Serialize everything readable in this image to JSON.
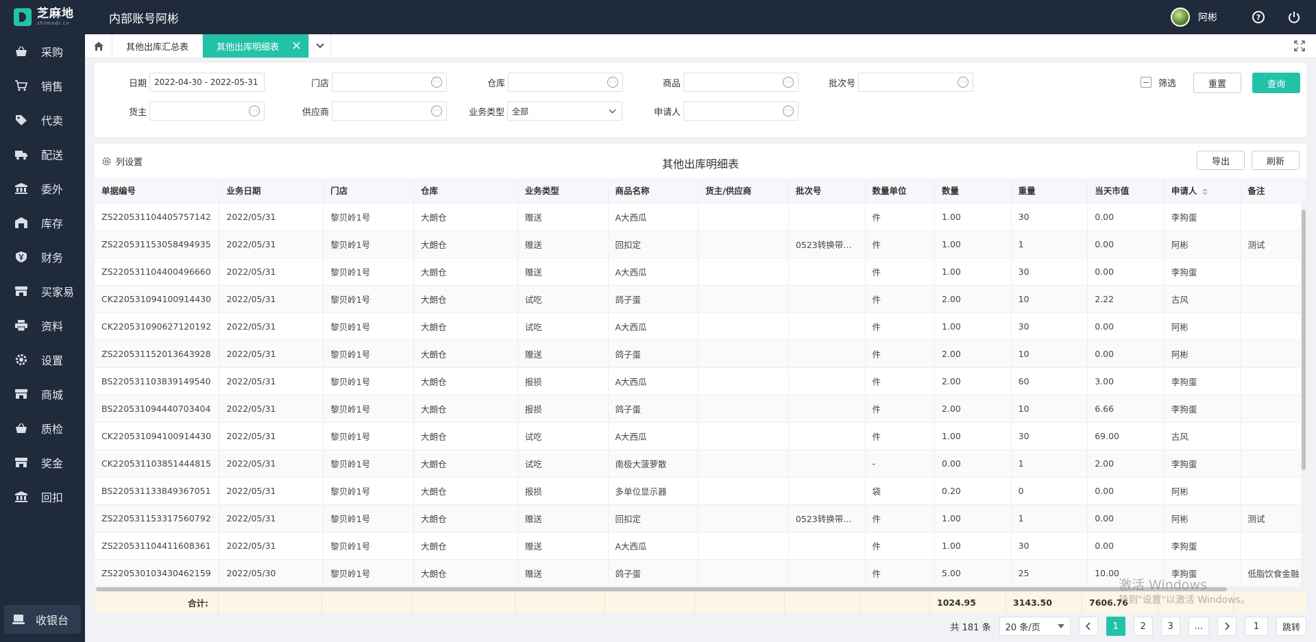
{
  "app": {
    "logo_text": "芝麻地",
    "logo_sub": "zhimadi.cn",
    "account_title": "内部账号阿彬",
    "username": "阿彬"
  },
  "colors": {
    "accent": "#23c2a8",
    "sidebar_bg": "#1f2a3b",
    "total_row_bg": "#fdf5e6"
  },
  "sidebar": {
    "items": [
      {
        "label": "采购",
        "icon": "basket-icon"
      },
      {
        "label": "销售",
        "icon": "cart-icon"
      },
      {
        "label": "代卖",
        "icon": "tag-icon"
      },
      {
        "label": "配送",
        "icon": "truck-icon"
      },
      {
        "label": "委外",
        "icon": "building-icon"
      },
      {
        "label": "库存",
        "icon": "warehouse-icon"
      },
      {
        "label": "财务",
        "icon": "yen-shield-icon"
      },
      {
        "label": "买家易",
        "icon": "store-icon"
      },
      {
        "label": "资料",
        "icon": "printer-icon"
      },
      {
        "label": "设置",
        "icon": "gear-icon"
      },
      {
        "label": "商城",
        "icon": "store-icon"
      },
      {
        "label": "质检",
        "icon": "basket-icon"
      },
      {
        "label": "奖金",
        "icon": "store-icon"
      },
      {
        "label": "回扣",
        "icon": "building-icon"
      }
    ],
    "cashier_label": "收银台"
  },
  "tabs": [
    {
      "label": "其他出库汇总表",
      "active": false
    },
    {
      "label": "其他出库明细表",
      "active": true
    }
  ],
  "filters": {
    "date_label": "日期",
    "date_value": "2022-04-30 - 2022-05-31",
    "store_label": "门店",
    "warehouse_label": "仓库",
    "product_label": "商品",
    "batch_label": "批次号",
    "owner_label": "货主",
    "supplier_label": "供应商",
    "biz_type_label": "业务类型",
    "biz_type_value": "全部",
    "applicant_label": "申请人",
    "filter_label": "筛选",
    "reset_label": "重置",
    "query_label": "查询"
  },
  "table_panel": {
    "col_settings_label": "列设置",
    "title": "其他出库明细表",
    "export_label": "导出",
    "refresh_label": "刷新"
  },
  "table": {
    "headers": [
      "单据编号",
      "业务日期",
      "门店",
      "仓库",
      "业务类型",
      "商品名称",
      "货主/供应商",
      "批次号",
      "数量单位",
      "数量",
      "重量",
      "当天市值",
      "申请人",
      "备注"
    ],
    "rows": [
      [
        "ZS220531104405757142",
        "2022/05/31",
        "黎贝岭1号",
        "大朗仓",
        "赠送",
        "A大西瓜",
        "",
        "",
        "件",
        "1.00",
        "30",
        "0.00",
        "李狗蛋",
        ""
      ],
      [
        "ZS220531153058494935",
        "2022/05/31",
        "黎贝岭1号",
        "大朗仓",
        "赠送",
        "回扣定",
        "",
        "0523转换带…",
        "件",
        "1.00",
        "1",
        "0.00",
        "阿彬",
        "测试"
      ],
      [
        "ZS220531104400496660",
        "2022/05/31",
        "黎贝岭1号",
        "大朗仓",
        "赠送",
        "A大西瓜",
        "",
        "",
        "件",
        "1.00",
        "30",
        "0.00",
        "李狗蛋",
        ""
      ],
      [
        "CK220531094100914430",
        "2022/05/31",
        "黎贝岭1号",
        "大朗仓",
        "试吃",
        "鸽子蛋",
        "",
        "",
        "件",
        "2.00",
        "10",
        "2.22",
        "古风",
        ""
      ],
      [
        "CK220531090627120192",
        "2022/05/31",
        "黎贝岭1号",
        "大朗仓",
        "试吃",
        "A大西瓜",
        "",
        "",
        "件",
        "1.00",
        "30",
        "0.00",
        "阿彬",
        ""
      ],
      [
        "ZS220531152013643928",
        "2022/05/31",
        "黎贝岭1号",
        "大朗仓",
        "赠送",
        "鸽子蛋",
        "",
        "",
        "件",
        "2.00",
        "10",
        "0.00",
        "阿彬",
        ""
      ],
      [
        "BS220531103839149540",
        "2022/05/31",
        "黎贝岭1号",
        "大朗仓",
        "报损",
        "A大西瓜",
        "",
        "",
        "件",
        "2.00",
        "60",
        "3.00",
        "李狗蛋",
        ""
      ],
      [
        "BS220531094440703404",
        "2022/05/31",
        "黎贝岭1号",
        "大朗仓",
        "报损",
        "鸽子蛋",
        "",
        "",
        "件",
        "2.00",
        "10",
        "6.66",
        "李狗蛋",
        ""
      ],
      [
        "CK220531094100914430",
        "2022/05/31",
        "黎贝岭1号",
        "大朗仓",
        "试吃",
        "A大西瓜",
        "",
        "",
        "件",
        "1.00",
        "30",
        "69.00",
        "古风",
        ""
      ],
      [
        "CK220531103851444815",
        "2022/05/31",
        "黎贝岭1号",
        "大朗仓",
        "试吃",
        "南极大菠萝散",
        "",
        "",
        "-",
        "0.00",
        "1",
        "2.00",
        "李狗蛋",
        ""
      ],
      [
        "BS220531133849367051",
        "2022/05/31",
        "黎贝岭1号",
        "大朗仓",
        "报损",
        "多单位显示器",
        "",
        "",
        "袋",
        "0.20",
        "0",
        "0.00",
        "阿彬",
        ""
      ],
      [
        "ZS220531153317560792",
        "2022/05/31",
        "黎贝岭1号",
        "大朗仓",
        "赠送",
        "回扣定",
        "",
        "0523转换带…",
        "件",
        "1.00",
        "1",
        "0.00",
        "阿彬",
        "测试"
      ],
      [
        "ZS220531104411608361",
        "2022/05/31",
        "黎贝岭1号",
        "大朗仓",
        "赠送",
        "A大西瓜",
        "",
        "",
        "件",
        "1.00",
        "30",
        "0.00",
        "李狗蛋",
        ""
      ],
      [
        "ZS220530103430462159",
        "2022/05/30",
        "黎贝岭1号",
        "大朗仓",
        "赠送",
        "鸽子蛋",
        "",
        "",
        "件",
        "5.00",
        "25",
        "10.00",
        "李狗蛋",
        "低脂饮食金融"
      ]
    ],
    "total_label": "合计:",
    "total_qty": "1024.95",
    "total_weight": "3143.50",
    "total_value": "7606.76"
  },
  "pagination": {
    "total_text": "共 181 条",
    "page_size": "20 条/页",
    "pages": [
      "1",
      "2",
      "3",
      "..."
    ],
    "current": "1",
    "jump_value": "1",
    "jump_label": "跳转"
  },
  "watermark": {
    "line1": "激活 Windows",
    "line2": "转到\"设置\"以激活 Windows。"
  }
}
